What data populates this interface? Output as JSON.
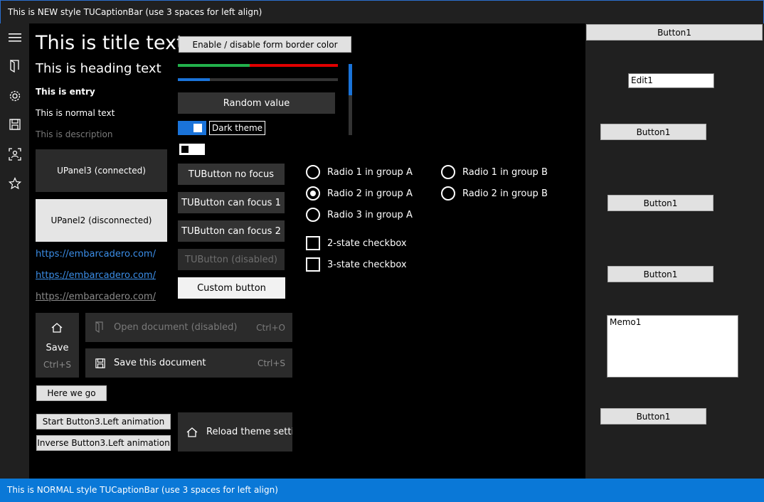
{
  "caption_bar": {
    "title": "This is NEW style TUCaptionBar (use 3 spaces for left align)"
  },
  "status_bar": {
    "title": "This is NORMAL style TUCaptionBar (use 3 spaces for left align)"
  },
  "sidebar": {
    "icons": [
      "hamburger-icon",
      "door-icon",
      "gear-icon",
      "save-icon",
      "user-frame-icon",
      "star-icon"
    ]
  },
  "texts": {
    "title": "This is title text",
    "heading": "This is heading text",
    "entry": "This is entry",
    "normal": "This is normal text",
    "description": "This is description"
  },
  "panels": {
    "upanel3": "UPanel3 (connected)",
    "upanel2": "UPanel2 (disconnected)"
  },
  "links": [
    "https://embarcadero.com/",
    "https://embarcadero.com/",
    "https://embarcadero.com/"
  ],
  "controls": {
    "border_color_button": "Enable / disable form border color",
    "progress": {
      "green": 0.45,
      "red": 0.55,
      "blue": 0.2
    },
    "random_value_button": "Random value",
    "dark_theme_label": "Dark theme",
    "dark_theme_on": true,
    "second_toggle_on": false
  },
  "tu_buttons": [
    {
      "label": "TUButton no focus",
      "disabled": false
    },
    {
      "label": "TUButton can focus 1",
      "disabled": false
    },
    {
      "label": "TUButton can focus 2",
      "disabled": false
    },
    {
      "label": "TUButton (disabled)",
      "disabled": true
    }
  ],
  "custom_button": "Custom button",
  "radio_group_a": [
    {
      "label": "Radio 1 in group A",
      "checked": false
    },
    {
      "label": "Radio 2 in group A",
      "checked": true
    },
    {
      "label": "Radio 3 in group A",
      "checked": false
    }
  ],
  "radio_group_b": [
    {
      "label": "Radio 1 in group B",
      "checked": false
    },
    {
      "label": "Radio 2 in group B",
      "checked": false
    }
  ],
  "checkboxes": [
    {
      "label": "2-state checkbox",
      "checked": false
    },
    {
      "label": "3-state checkbox",
      "checked": false
    }
  ],
  "save_tile": {
    "label": "Save",
    "shortcut": "Ctrl+S"
  },
  "menu_items": {
    "open": {
      "label": "Open document (disabled)",
      "shortcut": "Ctrl+O"
    },
    "save": {
      "label": "Save this document",
      "shortcut": "Ctrl+S"
    }
  },
  "here_we_go_button": "Here we go",
  "start_anim_button": "Start Button3.Left animation",
  "inverse_anim_button": "Inverse Button3.Left animation",
  "reload_theme_button": "Reload theme setting",
  "right_panel": {
    "top_button": "Button1",
    "edit1": "Edit1",
    "button_a": "Button1",
    "button_b": "Button1",
    "button_c": "Button1",
    "memo1": "Memo1",
    "button_d": "Button1"
  }
}
